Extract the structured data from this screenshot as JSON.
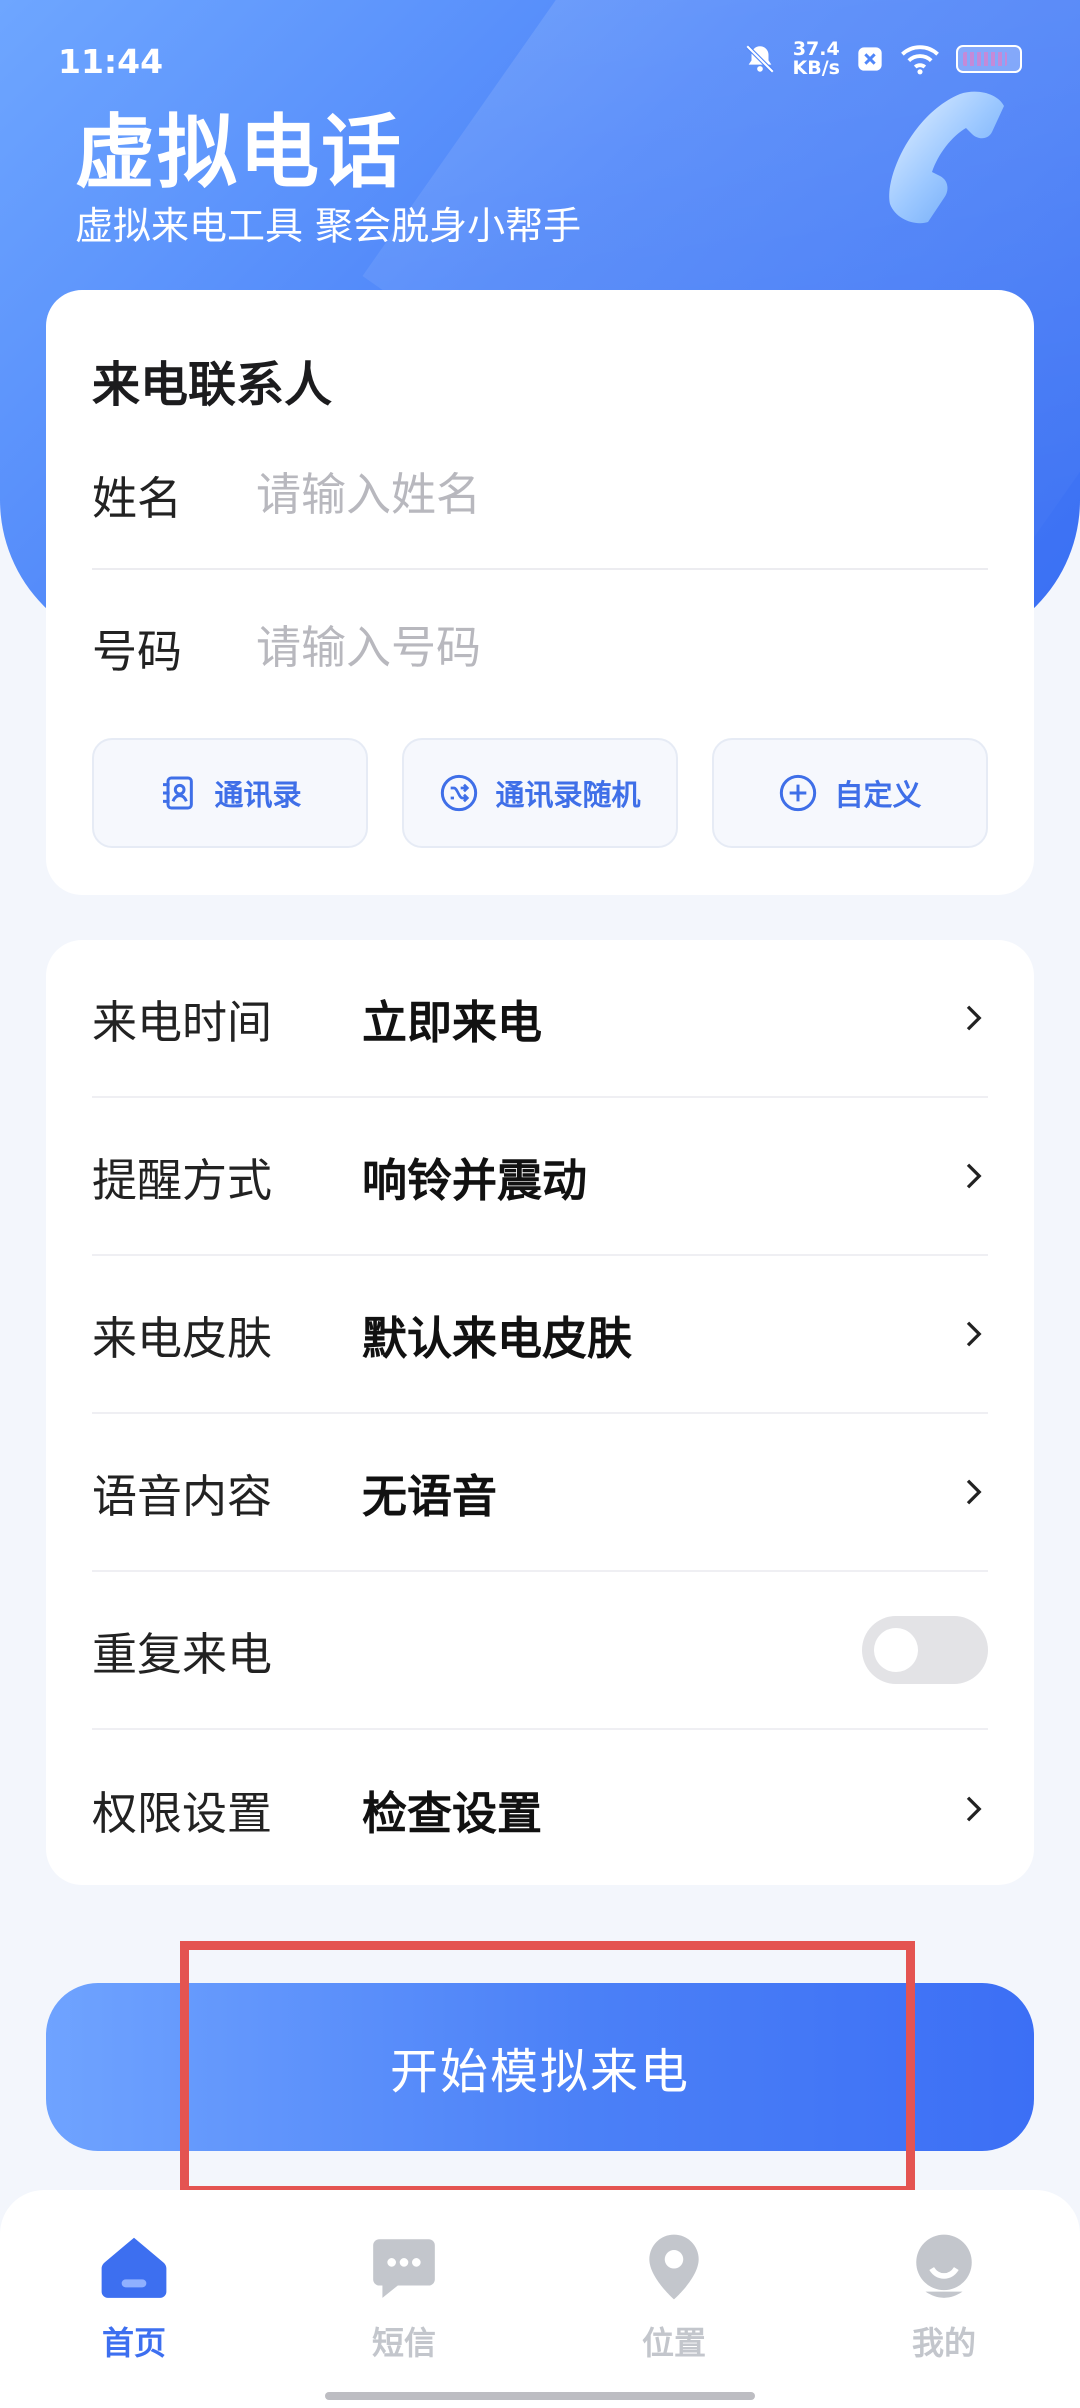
{
  "status_bar": {
    "time": "11:44",
    "net_speed_value": "37.4",
    "net_speed_unit": "KB/s"
  },
  "header": {
    "title": "虚拟电话",
    "subtitle": "虚拟来电工具 聚会脱身小帮手"
  },
  "contact": {
    "title": "来电联系人",
    "name_label": "姓名",
    "name_placeholder": "请输入姓名",
    "number_label": "号码",
    "number_placeholder": "请输入号码",
    "buttons": {
      "contacts": "通讯录",
      "random": "通讯录随机",
      "custom": "自定义"
    }
  },
  "settings": {
    "call_time_label": "来电时间",
    "call_time_value": "立即来电",
    "alert_label": "提醒方式",
    "alert_value": "响铃并震动",
    "skin_label": "来电皮肤",
    "skin_value": "默认来电皮肤",
    "voice_label": "语音内容",
    "voice_value": "无语音",
    "repeat_label": "重复来电",
    "repeat_enabled": false,
    "permission_label": "权限设置",
    "permission_value": "检查设置"
  },
  "start_button": "开始模拟来电",
  "tabs": {
    "home": "首页",
    "sms": "短信",
    "location": "位置",
    "mine": "我的"
  },
  "colors": {
    "accent": "#3d6ff0",
    "highlight": "#e45451"
  }
}
